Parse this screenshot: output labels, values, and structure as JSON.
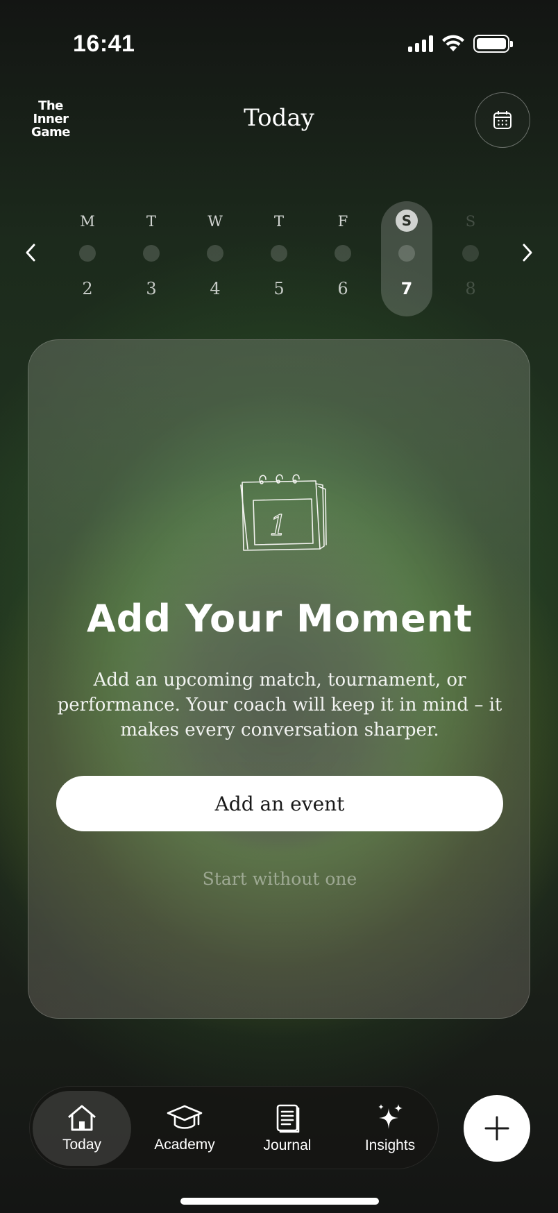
{
  "status_bar": {
    "time": "16:41"
  },
  "header": {
    "logo_lines": [
      "The",
      "Inner",
      "Game"
    ],
    "title": "Today"
  },
  "week": {
    "days": [
      {
        "dow": "M",
        "num": "2"
      },
      {
        "dow": "T",
        "num": "3"
      },
      {
        "dow": "W",
        "num": "4"
      },
      {
        "dow": "T",
        "num": "5"
      },
      {
        "dow": "F",
        "num": "6"
      },
      {
        "dow": "S",
        "num": "7",
        "selected": true
      },
      {
        "dow": "S",
        "num": "8",
        "future": true
      }
    ]
  },
  "card": {
    "illustration_number": "1",
    "title": "Add Your Moment",
    "description": "Add an upcoming match, tournament, or performance. Your coach will keep it in mind – it makes every conversation sharper.",
    "primary_button": "Add an event",
    "secondary_link": "Start without one"
  },
  "tabbar": {
    "tabs": [
      {
        "label": "Today",
        "icon": "home-icon",
        "active": true
      },
      {
        "label": "Academy",
        "icon": "graduation-cap-icon"
      },
      {
        "label": "Journal",
        "icon": "notebook-icon"
      },
      {
        "label": "Insights",
        "icon": "sparkles-icon"
      }
    ]
  },
  "fab": {
    "icon": "plus-icon"
  }
}
